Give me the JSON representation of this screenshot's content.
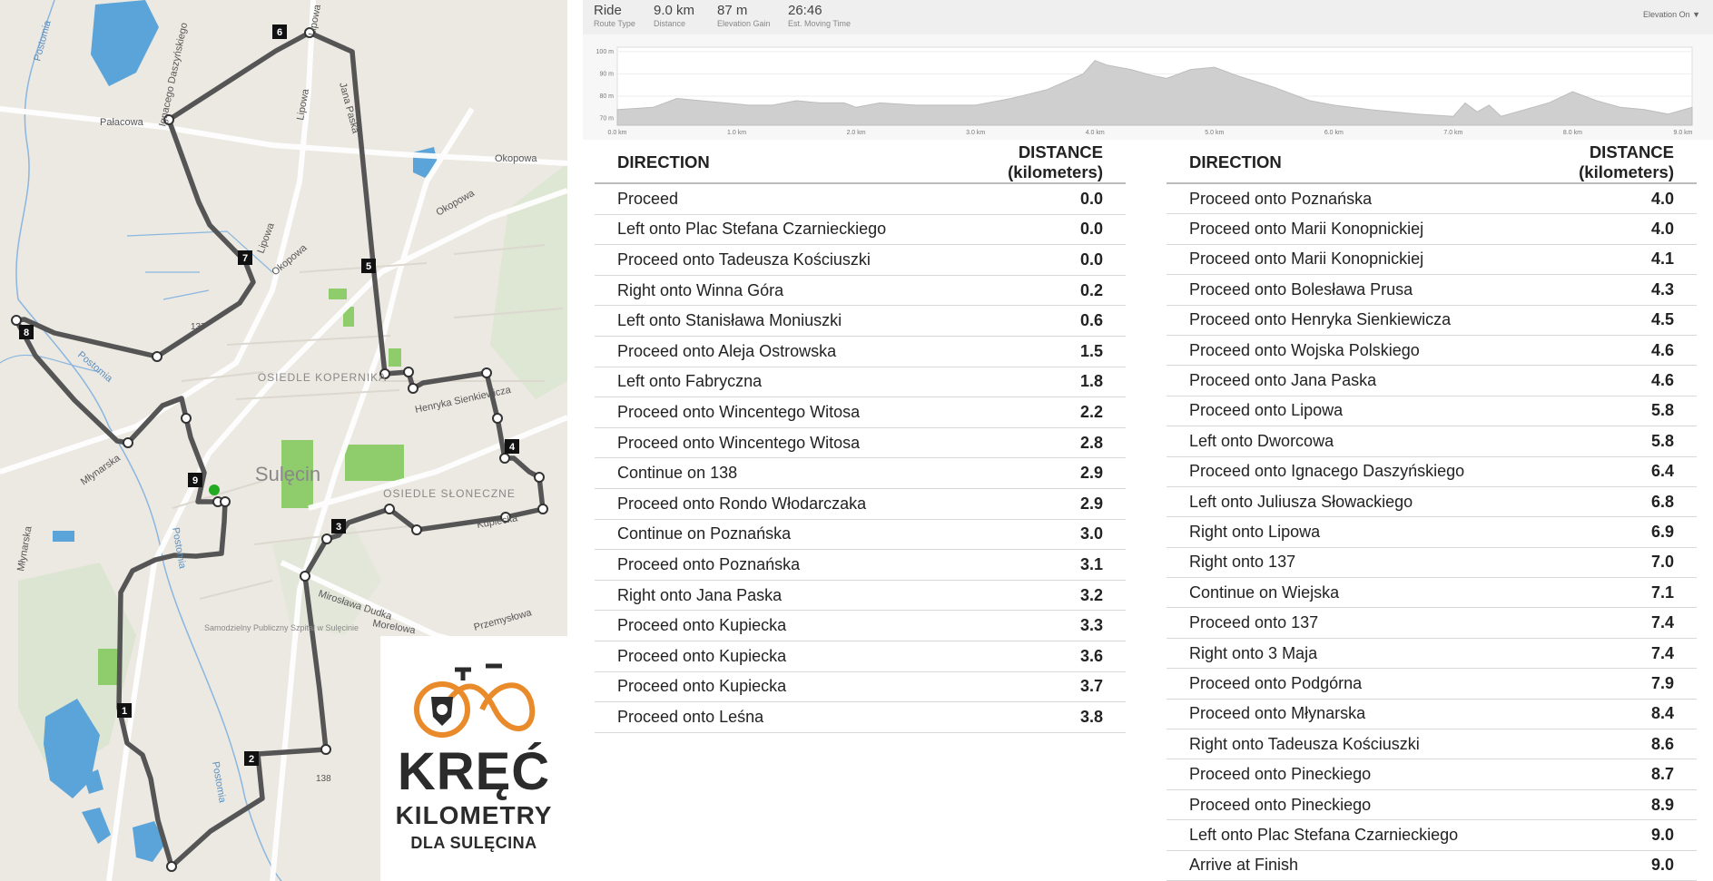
{
  "summary": {
    "route_type": {
      "value": "Ride",
      "label": "Route Type"
    },
    "distance": {
      "value": "9.0 km",
      "label": "Distance"
    },
    "elevation_gain": {
      "value": "87 m",
      "label": "Elevation Gain"
    },
    "moving_time": {
      "value": "26:46",
      "label": "Est. Moving Time"
    },
    "profile_toggle": "Elevation On ▼"
  },
  "elevation_profile": {
    "y_ticks": [
      "100 m",
      "90 m",
      "80 m",
      "70 m"
    ],
    "x_ticks": [
      "0.0 km",
      "1.0 km",
      "2.0 km",
      "3.0 km",
      "4.0 km",
      "5.0 km",
      "6.0 km",
      "7.0 km",
      "8.0 km",
      "9.0 km"
    ],
    "y_range": [
      67,
      102
    ],
    "x_range": [
      0,
      9.0
    ],
    "points_km_m": [
      [
        0,
        74
      ],
      [
        0.3,
        75
      ],
      [
        0.5,
        79
      ],
      [
        0.7,
        78
      ],
      [
        0.9,
        77
      ],
      [
        1.1,
        76
      ],
      [
        1.3,
        76
      ],
      [
        1.5,
        78
      ],
      [
        1.7,
        77
      ],
      [
        1.9,
        77
      ],
      [
        2.0,
        75
      ],
      [
        2.2,
        77
      ],
      [
        2.5,
        76
      ],
      [
        2.8,
        76
      ],
      [
        3.0,
        76
      ],
      [
        3.3,
        79
      ],
      [
        3.6,
        83
      ],
      [
        3.9,
        90
      ],
      [
        4.0,
        96
      ],
      [
        4.1,
        94
      ],
      [
        4.3,
        92
      ],
      [
        4.5,
        89
      ],
      [
        4.6,
        88
      ],
      [
        4.8,
        92
      ],
      [
        5.0,
        93
      ],
      [
        5.2,
        89
      ],
      [
        5.5,
        84
      ],
      [
        5.8,
        78
      ],
      [
        6.0,
        76
      ],
      [
        6.3,
        74
      ],
      [
        6.5,
        73
      ],
      [
        6.7,
        72
      ],
      [
        7.0,
        71
      ],
      [
        7.1,
        77
      ],
      [
        7.2,
        73
      ],
      [
        7.3,
        76
      ],
      [
        7.4,
        71
      ],
      [
        7.6,
        74
      ],
      [
        7.8,
        77
      ],
      [
        8.0,
        82
      ],
      [
        8.2,
        78
      ],
      [
        8.4,
        75
      ],
      [
        8.6,
        74
      ],
      [
        8.8,
        72
      ],
      [
        9.0,
        75
      ]
    ]
  },
  "map": {
    "road_labels": [
      "Postomia",
      "Lipowa",
      "Pałacowa",
      "Ignacego Daszyńskiego",
      "Jana Paska",
      "Okopowa",
      "Okopowa",
      "Okopowa",
      "Lipowa",
      "Lipowa",
      "137",
      "Postomia",
      "Henryka Sienkiewicza",
      "Młynarska",
      "Młynarska",
      "Postomia",
      "Kupiecka",
      "Mirosława Dudka",
      "Morelowa",
      "Przemysłowa",
      "138",
      "Postomia"
    ],
    "place_labels": [
      "OSIEDLE KOPERNIKA",
      "Sulęcin",
      "OSIEDLE SŁONECZNE",
      "Samodzielny Publiczny Szpital w Sulęcinie"
    ],
    "markers": [
      "1",
      "2",
      "3",
      "4",
      "5",
      "6",
      "7",
      "8",
      "9"
    ]
  },
  "logo": {
    "line1": "KRĘĆ",
    "line2": "KILOMETRY",
    "line3": "DLA SULĘCINA"
  },
  "directions": {
    "header_direction": "DIRECTION",
    "header_distance": "DISTANCE (kilometers)",
    "left": [
      {
        "direction": "Proceed",
        "distance": "0.0"
      },
      {
        "direction": "Left onto Plac Stefana Czarnieckiego",
        "distance": "0.0"
      },
      {
        "direction": "Proceed onto Tadeusza Kościuszki",
        "distance": "0.0"
      },
      {
        "direction": "Right onto Winna Góra",
        "distance": "0.2"
      },
      {
        "direction": "Left onto Stanisława Moniuszki",
        "distance": "0.6"
      },
      {
        "direction": "Proceed onto Aleja Ostrowska",
        "distance": "1.5"
      },
      {
        "direction": "Left onto Fabryczna",
        "distance": "1.8"
      },
      {
        "direction": "Proceed onto Wincentego Witosa",
        "distance": "2.2"
      },
      {
        "direction": "Proceed onto Wincentego Witosa",
        "distance": "2.8"
      },
      {
        "direction": "Continue on 138",
        "distance": "2.9"
      },
      {
        "direction": "Proceed onto Rondo Włodarczaka",
        "distance": "2.9"
      },
      {
        "direction": "Continue on Poznańska",
        "distance": "3.0"
      },
      {
        "direction": "Proceed onto Poznańska",
        "distance": "3.1"
      },
      {
        "direction": "Right onto Jana Paska",
        "distance": "3.2"
      },
      {
        "direction": "Proceed onto Kupiecka",
        "distance": "3.3"
      },
      {
        "direction": "Proceed onto Kupiecka",
        "distance": "3.6"
      },
      {
        "direction": "Proceed onto Kupiecka",
        "distance": "3.7"
      },
      {
        "direction": "Proceed onto Leśna",
        "distance": "3.8"
      }
    ],
    "right": [
      {
        "direction": "Proceed onto Poznańska",
        "distance": "4.0"
      },
      {
        "direction": "Proceed onto Marii Konopnickiej",
        "distance": "4.0"
      },
      {
        "direction": "Proceed onto Marii Konopnickiej",
        "distance": "4.1"
      },
      {
        "direction": "Proceed onto Bolesława Prusa",
        "distance": "4.3"
      },
      {
        "direction": "Proceed onto Henryka Sienkiewicza",
        "distance": "4.5"
      },
      {
        "direction": "Proceed onto Wojska Polskiego",
        "distance": "4.6"
      },
      {
        "direction": "Proceed onto Jana Paska",
        "distance": "4.6"
      },
      {
        "direction": "Proceed onto Lipowa",
        "distance": "5.8"
      },
      {
        "direction": "Left onto Dworcowa",
        "distance": "5.8"
      },
      {
        "direction": "Proceed onto Ignacego Daszyńskiego",
        "distance": "6.4"
      },
      {
        "direction": "Left onto Juliusza Słowackiego",
        "distance": "6.8"
      },
      {
        "direction": "Right onto Lipowa",
        "distance": "6.9"
      },
      {
        "direction": "Right onto 137",
        "distance": "7.0"
      },
      {
        "direction": "Continue on Wiejska",
        "distance": "7.1"
      },
      {
        "direction": "Proceed onto 137",
        "distance": "7.4"
      },
      {
        "direction": "Right onto 3 Maja",
        "distance": "7.4"
      },
      {
        "direction": "Proceed onto Podgórna",
        "distance": "7.9"
      },
      {
        "direction": "Proceed onto Młynarska",
        "distance": "8.4"
      },
      {
        "direction": "Right onto Tadeusza Kościuszki",
        "distance": "8.6"
      },
      {
        "direction": "Proceed onto Pineckiego",
        "distance": "8.7"
      },
      {
        "direction": "Proceed onto Pineckiego",
        "distance": "8.9"
      },
      {
        "direction": "Left onto Plac Stefana Czarnieckiego",
        "distance": "9.0"
      },
      {
        "direction": "Arrive at Finish",
        "distance": "9.0"
      }
    ]
  },
  "colors": {
    "route": "#555555",
    "water": "#5ba4d9",
    "park": "#8fcc6c",
    "logo_orange": "#e98a2b",
    "start_marker": "#22aa22"
  }
}
